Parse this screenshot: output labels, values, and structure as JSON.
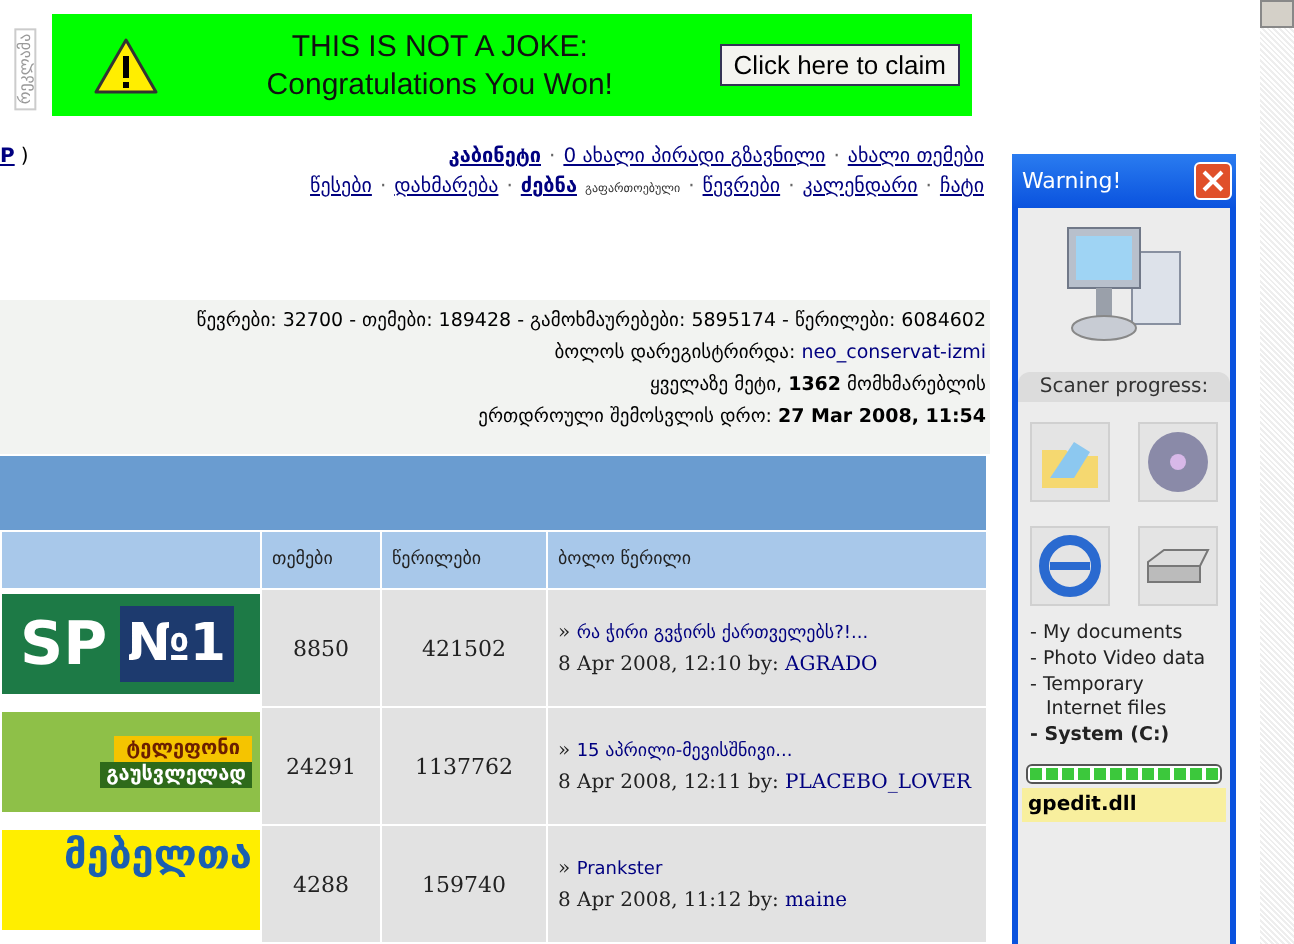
{
  "side_label": "რეკლამა",
  "ad_banner": {
    "headline": "THIS IS NOT A JOKE:",
    "subline": "Congratulations You Won!",
    "button": "Click here to claim"
  },
  "user_fragment": {
    "link": "P",
    "suffix": ")"
  },
  "nav_separator": "·",
  "nav_rows": [
    [
      {
        "label": "კაბინეტი",
        "bold": true
      },
      {
        "label": "0 ახალი პირადი გზავნილი",
        "bold": false
      },
      {
        "label": "ახალი თემები",
        "bold": false
      }
    ],
    [
      {
        "label": "წესები",
        "bold": false
      },
      {
        "label": "დახმარება",
        "bold": false
      },
      {
        "label": "ძებნა",
        "bold": true,
        "note": "გაფართოებული"
      },
      {
        "label": "წევრები",
        "bold": false
      },
      {
        "label": "კალენდარი",
        "bold": false
      },
      {
        "label": "ჩატი",
        "bold": false
      }
    ]
  ],
  "stats": {
    "totals": "წევრები: 32700 - თემები: 189428 - გამოხმაურებები: 5895174 - წერილები: 6084602",
    "last_registered_label": "ბოლოს დარეგისტრირდა:",
    "last_registered_user": "neo_conservat-izmi",
    "most_online": "ყველაზე მეტი, **1362** მომხმარებლის",
    "most_online_time": "ერთდროული შემოსვლის დრო: **27 Mar 2008, 11:54**"
  },
  "table": {
    "columns": [
      "თემები",
      "წერილები",
      "ბოლო წერილი"
    ],
    "rows": [
      {
        "ad": {
          "kind": "sp",
          "lines": [
            "SP",
            "№1"
          ]
        },
        "topics": "8850",
        "posts": "421502",
        "last_post": {
          "marker": "»",
          "title": "რა ჭირი გვჭირს ქართველებს?!...",
          "date": "8 Apr 2008, 12:10 by:",
          "user": "AGRADO"
        }
      },
      {
        "ad": {
          "kind": "phone",
          "lines": [
            "ტელეფონი",
            "გაუსვლელად"
          ]
        },
        "topics": "24291",
        "posts": "1137762",
        "last_post": {
          "marker": "»",
          "title": "15 აპრილი-მევისშნივი...",
          "date": "8 Apr 2008, 12:11 by:",
          "user": "PLACEBO_LOVER"
        }
      },
      {
        "ad": {
          "kind": "furniture",
          "lines": [
            "მებელთა"
          ]
        },
        "topics": "4288",
        "posts": "159740",
        "last_post": {
          "marker": "»",
          "title": "Prankster",
          "date": "8 Apr 2008, 11:12 by:",
          "user": "maine"
        }
      }
    ]
  },
  "popup": {
    "title": "Warning!",
    "progress_label": "Scaner progress:",
    "items": [
      {
        "text": "- My documents",
        "current": false
      },
      {
        "text": "- Photo Video data",
        "current": false
      },
      {
        "text": "- Temporary Internet files",
        "current": false
      },
      {
        "text": "- System (C:)",
        "current": true
      }
    ],
    "progress": {
      "level": 1.0
    },
    "file": "gpedit.dll"
  }
}
